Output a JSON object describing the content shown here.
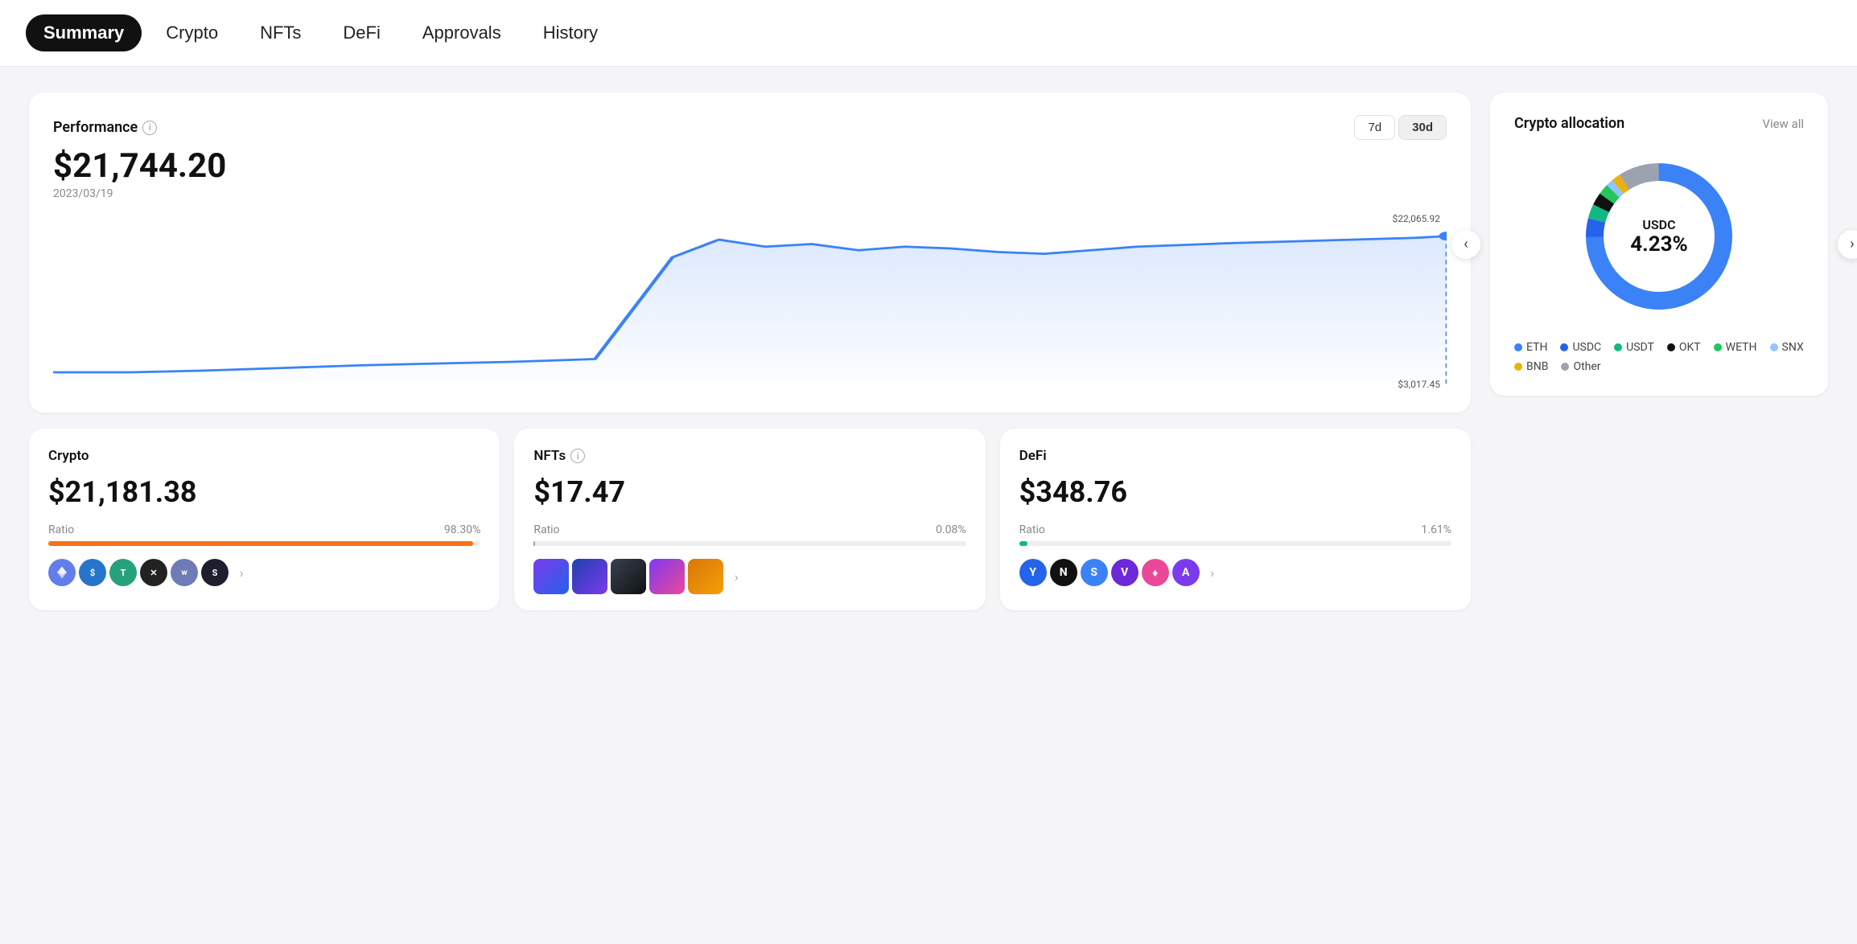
{
  "nav": {
    "items": [
      {
        "label": "Summary",
        "active": true
      },
      {
        "label": "Crypto",
        "active": false
      },
      {
        "label": "NFTs",
        "active": false
      },
      {
        "label": "DeFi",
        "active": false
      },
      {
        "label": "Approvals",
        "active": false
      },
      {
        "label": "History",
        "active": false
      }
    ]
  },
  "performance": {
    "title": "Performance",
    "value": "$21,744.20",
    "date": "2023/03/19",
    "period_7d": "7d",
    "period_30d": "30d",
    "chart_high": "$22,065.92",
    "chart_low": "$3,017.45"
  },
  "crypto_allocation": {
    "title": "Crypto allocation",
    "view_all": "View all",
    "center_label": "USDC",
    "center_pct": "4.23%",
    "legend": [
      {
        "label": "ETH",
        "color": "#3b82f6"
      },
      {
        "label": "USDC",
        "color": "#2563eb"
      },
      {
        "label": "USDT",
        "color": "#10b981"
      },
      {
        "label": "OKT",
        "color": "#111111"
      },
      {
        "label": "WETH",
        "color": "#22c55e"
      },
      {
        "label": "SNX",
        "color": "#93c5fd"
      },
      {
        "label": "BNB",
        "color": "#eab308"
      },
      {
        "label": "Other",
        "color": "#9ca3af"
      }
    ]
  },
  "crypto_card": {
    "label": "Crypto",
    "value": "$21,181.38",
    "ratio_label": "Ratio",
    "ratio_pct": "98.30%",
    "ratio_fill": 98.3,
    "bar_color": "#f97316"
  },
  "nfts_card": {
    "label": "NFTs",
    "value": "$17.47",
    "ratio_label": "Ratio",
    "ratio_pct": "0.08%",
    "ratio_fill": 0.08,
    "bar_color": "#9ca3af"
  },
  "defi_card": {
    "label": "DeFi",
    "value": "$348.76",
    "ratio_label": "Ratio",
    "ratio_pct": "1.61%",
    "ratio_fill": 1.61,
    "bar_color": "#10b981"
  }
}
